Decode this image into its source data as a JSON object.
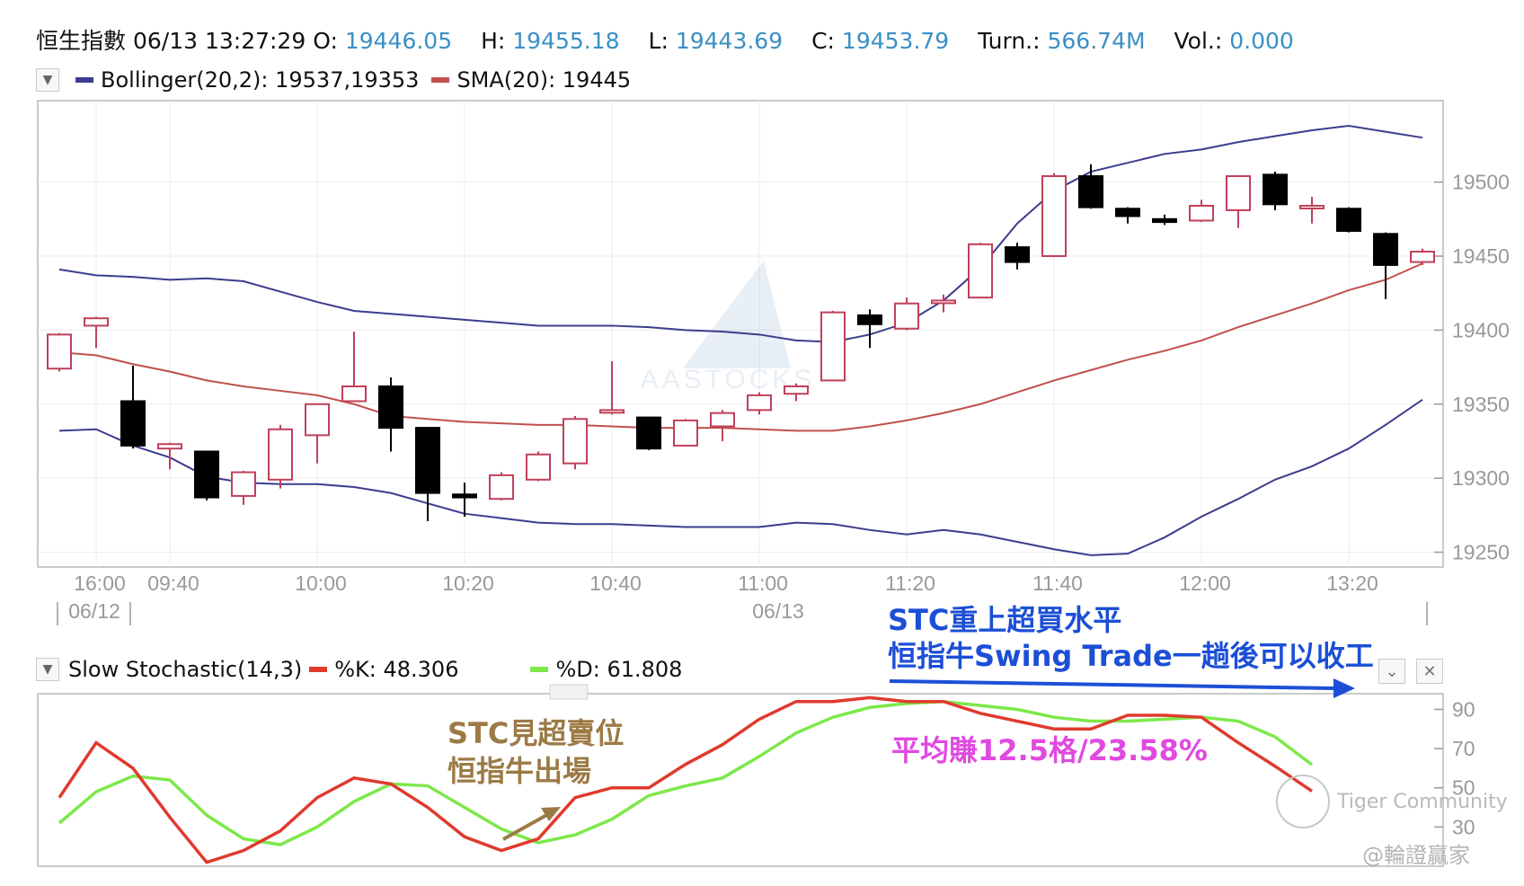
{
  "header": {
    "name": "恒生指數",
    "datetime": "06/13 13:27:29",
    "o_label": "O:",
    "o_value": "19446.05",
    "h_label": "H:",
    "h_value": "19455.18",
    "l_label": "L:",
    "l_value": "19443.69",
    "c_label": "C:",
    "c_value": "19453.79",
    "turn_label": "Turn.:",
    "turn_value": "566.74M",
    "vol_label": "Vol.:",
    "vol_value": "0.000"
  },
  "main_legend": {
    "bollinger_label": "Bollinger(20,2): 19537,19353",
    "sma_label": "SMA(20): 19445"
  },
  "stoch_legend": {
    "title": "Slow Stochastic(14,3)",
    "k_label": "%K: 48.306",
    "d_label": "%D: 61.808"
  },
  "annotations": {
    "gold_line1": "STC見超賣位",
    "gold_line2": "恒指牛出場",
    "blue_line1": "STC重上超買水平",
    "blue_line2": "恒指牛Swing Trade一趟後可以收工",
    "pink": "平均賺12.5格/23.58%"
  },
  "watermarks": {
    "center": "AASTOCKS",
    "community": "Tiger Community",
    "weibo": "@輪證贏家"
  },
  "colors": {
    "bollinger": "#3c3c8f",
    "sma": "#c0504d",
    "bull_candle": "#c0405a",
    "bear_candle": "#000000",
    "stoch_k": "#e03a2e",
    "stoch_d": "#7de84a",
    "value_text": "#3b8fc4"
  },
  "chart_data": [
    {
      "type": "candlestick",
      "title": "恒生指數",
      "ylim": [
        19240,
        19555
      ],
      "y_ticks": [
        19250,
        19300,
        19350,
        19400,
        19450,
        19500
      ],
      "x_tick_labels": [
        "16:00",
        "09:40",
        "10:00",
        "10:20",
        "10:40",
        "11:00",
        "11:20",
        "11:40",
        "12:00",
        "13:20"
      ],
      "date_labels": [
        "06/12",
        "06/13"
      ],
      "candles": [
        {
          "o": 19374,
          "h": 19398,
          "l": 19372,
          "c": 19397
        },
        {
          "o": 19403,
          "h": 19409,
          "l": 19388,
          "c": 19408
        },
        {
          "o": 19352,
          "h": 19376,
          "l": 19320,
          "c": 19322
        },
        {
          "o": 19320,
          "h": 19324,
          "l": 19306,
          "c": 19323
        },
        {
          "o": 19318,
          "h": 19318,
          "l": 19285,
          "c": 19287
        },
        {
          "o": 19288,
          "h": 19305,
          "l": 19282,
          "c": 19304
        },
        {
          "o": 19299,
          "h": 19336,
          "l": 19293,
          "c": 19333
        },
        {
          "o": 19329,
          "h": 19350,
          "l": 19310,
          "c": 19350
        },
        {
          "o": 19352,
          "h": 19399,
          "l": 19352,
          "c": 19362
        },
        {
          "o": 19362,
          "h": 19368,
          "l": 19318,
          "c": 19334
        },
        {
          "o": 19334,
          "h": 19334,
          "l": 19271,
          "c": 19290
        },
        {
          "o": 19289,
          "h": 19297,
          "l": 19274,
          "c": 19287
        },
        {
          "o": 19286,
          "h": 19304,
          "l": 19285,
          "c": 19302
        },
        {
          "o": 19299,
          "h": 19318,
          "l": 19298,
          "c": 19316
        },
        {
          "o": 19310,
          "h": 19342,
          "l": 19306,
          "c": 19340
        },
        {
          "o": 19345,
          "h": 19379,
          "l": 19343,
          "c": 19346
        },
        {
          "o": 19341,
          "h": 19341,
          "l": 19319,
          "c": 19320
        },
        {
          "o": 19322,
          "h": 19340,
          "l": 19322,
          "c": 19339
        },
        {
          "o": 19335,
          "h": 19346,
          "l": 19325,
          "c": 19344
        },
        {
          "o": 19346,
          "h": 19358,
          "l": 19343,
          "c": 19356
        },
        {
          "o": 19357,
          "h": 19364,
          "l": 19352,
          "c": 19362
        },
        {
          "o": 19366,
          "h": 19413,
          "l": 19366,
          "c": 19412
        },
        {
          "o": 19410,
          "h": 19414,
          "l": 19388,
          "c": 19404
        },
        {
          "o": 19401,
          "h": 19422,
          "l": 19400,
          "c": 19418
        },
        {
          "o": 19420,
          "h": 19424,
          "l": 19412,
          "c": 19420
        },
        {
          "o": 19422,
          "h": 19459,
          "l": 19422,
          "c": 19458
        },
        {
          "o": 19456,
          "h": 19459,
          "l": 19441,
          "c": 19446
        },
        {
          "o": 19450,
          "h": 19506,
          "l": 19450,
          "c": 19504
        },
        {
          "o": 19504,
          "h": 19512,
          "l": 19482,
          "c": 19483
        },
        {
          "o": 19482,
          "h": 19483,
          "l": 19472,
          "c": 19477
        },
        {
          "o": 19475,
          "h": 19478,
          "l": 19471,
          "c": 19473
        },
        {
          "o": 19474,
          "h": 19488,
          "l": 19473,
          "c": 19484
        },
        {
          "o": 19481,
          "h": 19504,
          "l": 19469,
          "c": 19504
        },
        {
          "o": 19505,
          "h": 19507,
          "l": 19481,
          "c": 19485
        },
        {
          "o": 19484,
          "h": 19490,
          "l": 19472,
          "c": 19484
        },
        {
          "o": 19482,
          "h": 19483,
          "l": 19466,
          "c": 19467
        },
        {
          "o": 19465,
          "h": 19466,
          "l": 19421,
          "c": 19444
        },
        {
          "o": 19446,
          "h": 19455,
          "l": 19444,
          "c": 19453
        }
      ],
      "bollinger_upper": [
        19441,
        19437,
        19436,
        19434,
        19435,
        19433,
        19426,
        19419,
        19413,
        19411,
        19409,
        19407,
        19405,
        19403,
        19403,
        19403,
        19402,
        19400,
        19399,
        19397,
        19393,
        19392,
        19397,
        19405,
        19420,
        19442,
        19472,
        19494,
        19507,
        19513,
        19519,
        19522,
        19527,
        19531,
        19535,
        19538,
        19534,
        19530
      ],
      "bollinger_lower": [
        19332,
        19333,
        19322,
        19314,
        19301,
        19297,
        19296,
        19296,
        19294,
        19290,
        19283,
        19276,
        19273,
        19270,
        19269,
        19269,
        19268,
        19267,
        19267,
        19267,
        19270,
        19269,
        19265,
        19262,
        19265,
        19262,
        19257,
        19252,
        19248,
        19249,
        19260,
        19274,
        19286,
        19299,
        19308,
        19320,
        19336,
        19353
      ],
      "sma": [
        19385,
        19383,
        19377,
        19372,
        19366,
        19362,
        19359,
        19356,
        19350,
        19342,
        19340,
        19338,
        19337,
        19336,
        19336,
        19335,
        19334,
        19334,
        19334,
        19333,
        19332,
        19332,
        19335,
        19339,
        19344,
        19350,
        19358,
        19366,
        19373,
        19380,
        19386,
        19393,
        19402,
        19410,
        19418,
        19427,
        19434,
        19445
      ]
    },
    {
      "type": "line",
      "title": "Slow Stochastic(14,3)",
      "ylim": [
        10,
        98
      ],
      "y_ticks": [
        30,
        50,
        70,
        90
      ],
      "series": [
        {
          "name": "%K",
          "values": [
            45,
            73,
            60,
            35,
            12,
            18,
            28,
            45,
            55,
            52,
            40,
            25,
            18,
            24,
            45,
            50,
            50,
            62,
            72,
            85,
            94,
            94,
            96,
            94,
            94,
            88,
            84,
            80,
            80,
            87,
            87,
            86,
            73,
            61,
            48.306
          ]
        },
        {
          "name": "%D",
          "values": [
            32,
            48,
            56,
            54,
            36,
            24,
            21,
            30,
            43,
            52,
            51,
            40,
            29,
            22,
            26,
            34,
            46,
            51,
            55,
            66,
            78,
            86,
            91,
            93,
            94,
            92,
            90,
            86,
            84,
            84,
            85,
            86,
            84,
            76,
            61.808
          ]
        }
      ]
    }
  ]
}
